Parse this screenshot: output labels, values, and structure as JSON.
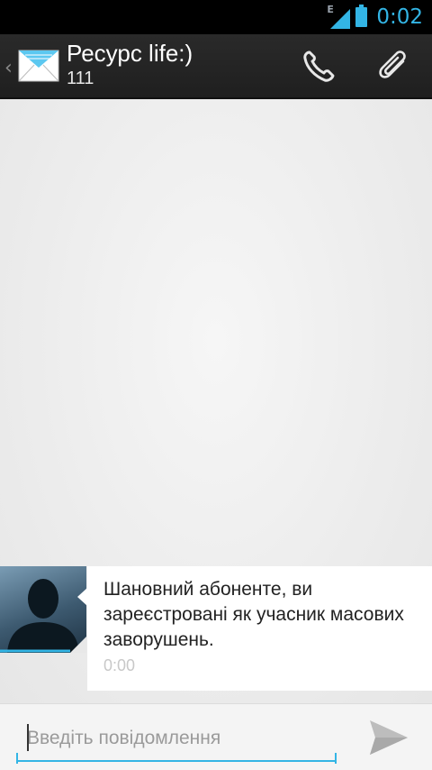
{
  "status_bar": {
    "network_type": "E",
    "time": "0:02",
    "icons": [
      "signal-icon",
      "battery-icon"
    ]
  },
  "action_bar": {
    "title": "Ресурс life:)",
    "subtitle": "111",
    "actions": [
      "phone-icon",
      "attachment-icon"
    ]
  },
  "conversation": {
    "messages": [
      {
        "text": "Шановний абоненте, ви зареєстровані як учасник масових заворушень.",
        "time": "0:00"
      }
    ]
  },
  "compose": {
    "placeholder": "Введіть повідомлення",
    "value": ""
  },
  "colors": {
    "accent": "#33b5e5",
    "status_bar": "#000000",
    "action_bar": "#222222",
    "background": "#ececec"
  }
}
